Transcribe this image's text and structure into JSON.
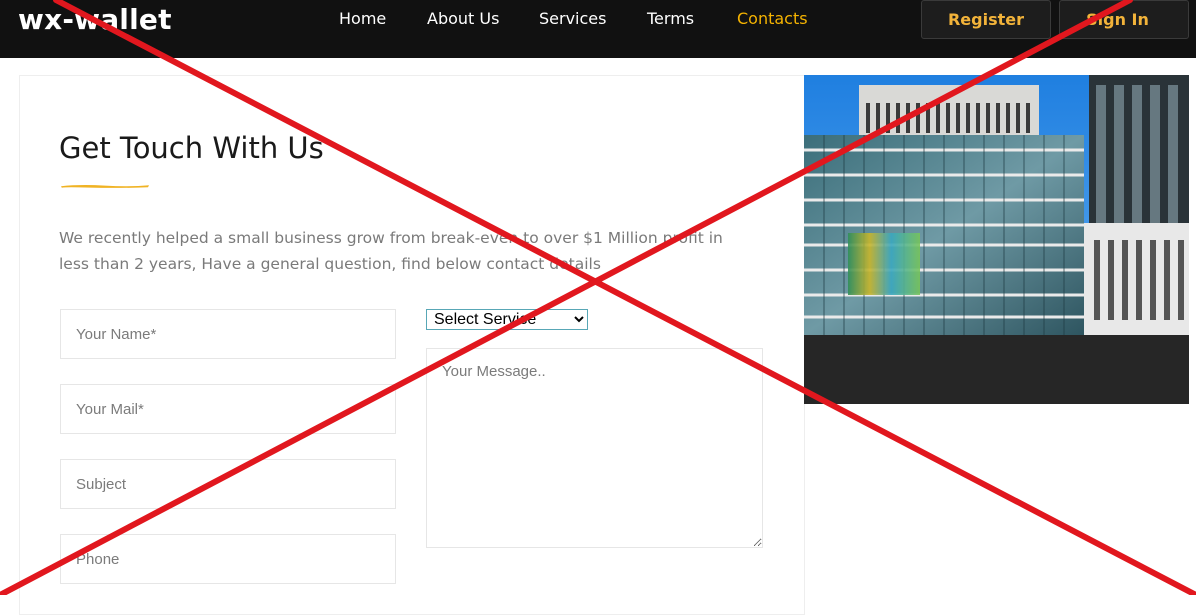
{
  "header": {
    "logo": "wx-wallet",
    "nav": [
      {
        "label": "Home",
        "active": false
      },
      {
        "label": "About Us",
        "active": false
      },
      {
        "label": "Services",
        "active": false
      },
      {
        "label": "Terms",
        "active": false
      },
      {
        "label": "Contacts",
        "active": true
      }
    ],
    "register_label": "Register",
    "signin_label": "Sign In"
  },
  "contact": {
    "title": "Get Touch With Us",
    "description": "We recently helped a small business grow from break-even to over $1 Million profit in less than 2 years, Have a general question, find below contact details",
    "fields": {
      "name_placeholder": "Your Name*",
      "mail_placeholder": "Your Mail*",
      "subject_placeholder": "Subject",
      "phone_placeholder": "Phone",
      "service_selected": "Select Service",
      "message_placeholder": "Your Message.."
    }
  },
  "colors": {
    "header_bg": "#111111",
    "accent": "#f5b301",
    "button_text": "#f2b33a",
    "overlay_red": "#e1171e"
  },
  "icons": {
    "select_arrow": "chevron-down-icon",
    "overlay": "red-x-cross-icon"
  }
}
